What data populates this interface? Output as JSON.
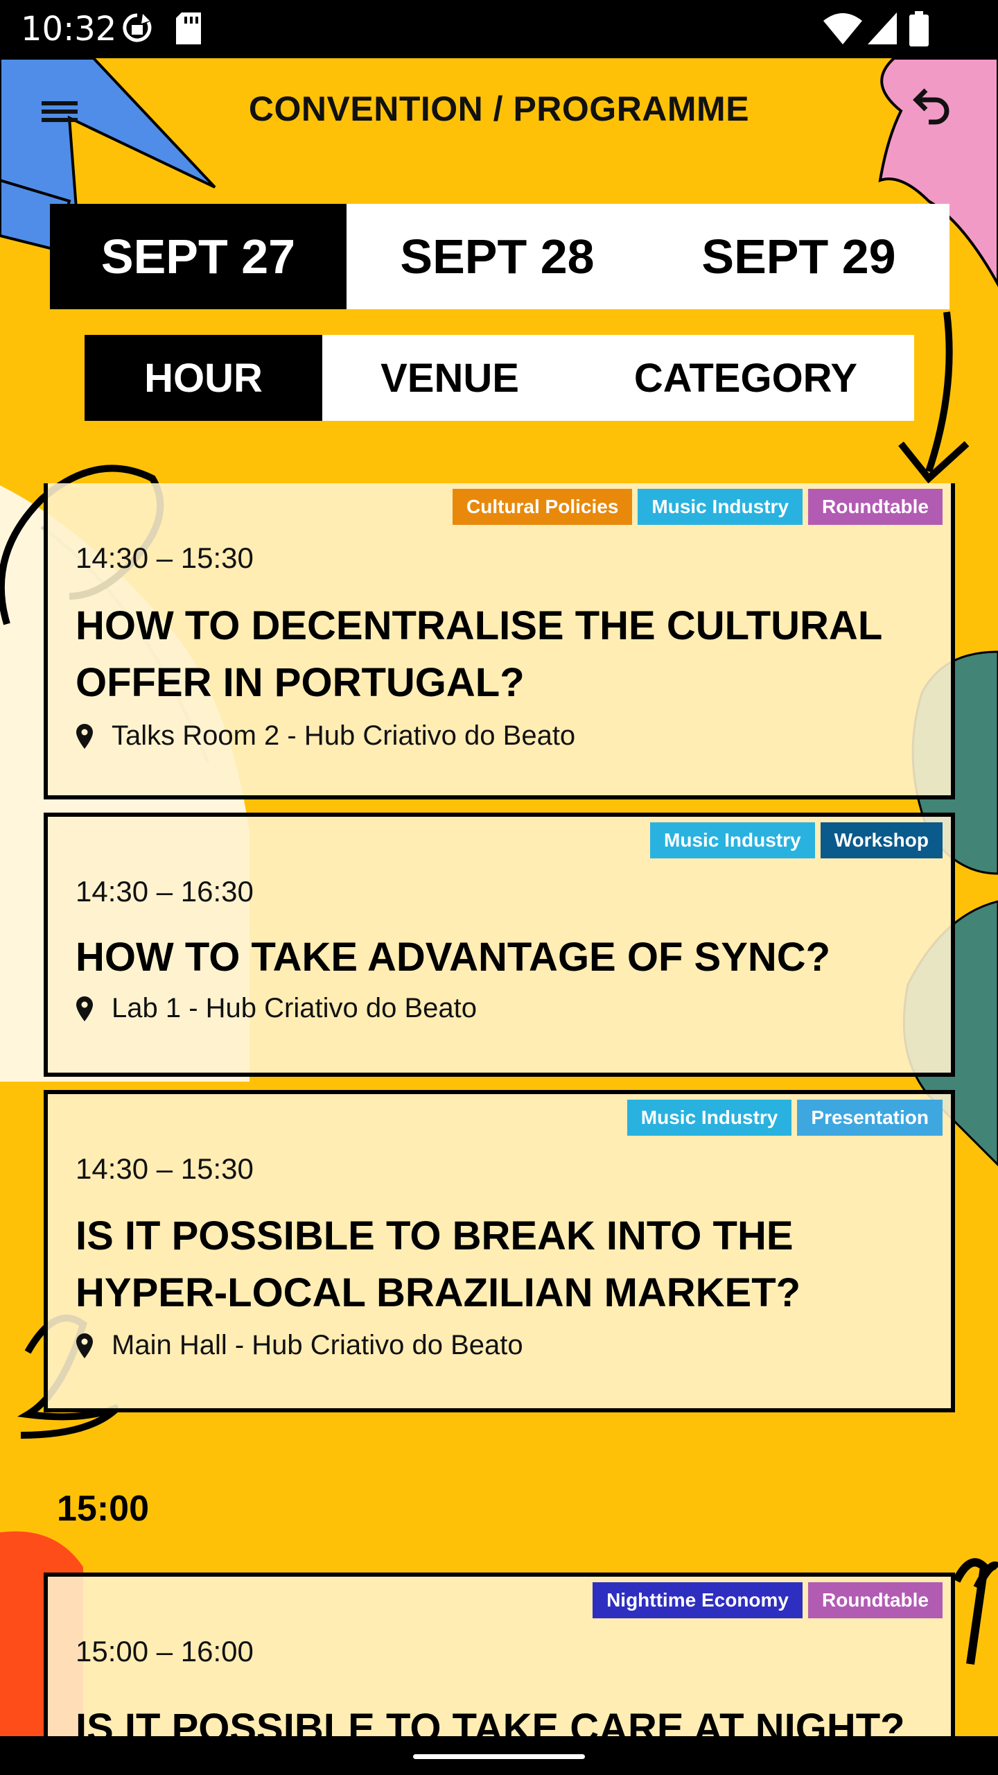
{
  "status_bar": {
    "time": "10:32"
  },
  "header": {
    "title": "CONVENTION / PROGRAMME"
  },
  "colors": {
    "background": "#ffc107",
    "card_bg": "#fff3cd",
    "tag_cultural_policies": "#e8890c",
    "tag_music_industry": "#29b2e0",
    "tag_roundtable": "#b25bb3",
    "tag_workshop": "#0a5a8c",
    "tag_presentation": "#3fa7e0",
    "tag_nighttime_economy": "#2e2ec0"
  },
  "days": [
    {
      "label": "SEPT 27",
      "active": true
    },
    {
      "label": "SEPT 28",
      "active": false
    },
    {
      "label": "SEPT 29",
      "active": false
    }
  ],
  "views": [
    {
      "label": "HOUR",
      "active": true
    },
    {
      "label": "VENUE",
      "active": false
    },
    {
      "label": "CATEGORY",
      "active": false
    }
  ],
  "events": [
    {
      "tags": [
        "Cultural Policies",
        "Music Industry",
        "Roundtable"
      ],
      "time": "14:30 – 15:30",
      "title": "HOW TO DECENTRALISE THE CULTURAL OFFER IN PORTUGAL?",
      "venue": "Talks Room 2 - Hub Criativo do Beato"
    },
    {
      "tags": [
        "Music Industry",
        "Workshop"
      ],
      "time": "14:30 – 16:30",
      "title": "HOW TO TAKE ADVANTAGE OF SYNC?",
      "venue": "Lab 1 - Hub Criativo do Beato"
    },
    {
      "tags": [
        "Music Industry",
        "Presentation"
      ],
      "time": "14:30 – 15:30",
      "title": "IS IT POSSIBLE TO BREAK INTO THE HYPER-LOCAL BRAZILIAN MARKET?",
      "venue": "Main Hall - Hub Criativo do Beato"
    },
    {
      "tags": [
        "Nighttime Economy",
        "Roundtable"
      ],
      "time": "15:00 – 16:00",
      "title": "IS IT POSSIBLE TO TAKE CARE AT NIGHT?",
      "venue": ""
    }
  ],
  "hour_group": "15:00"
}
